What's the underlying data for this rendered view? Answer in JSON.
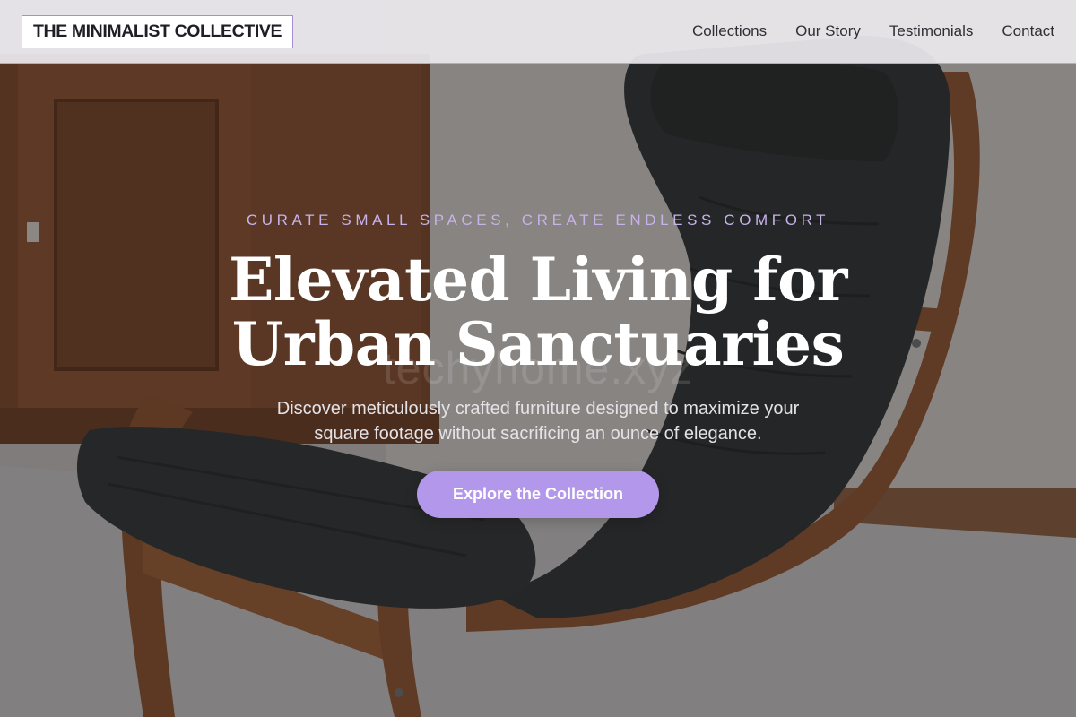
{
  "header": {
    "logo_text": "THE MINIMALIST COLLECTIVE",
    "nav": [
      {
        "label": "Collections"
      },
      {
        "label": "Our Story"
      },
      {
        "label": "Testimonials"
      },
      {
        "label": "Contact"
      }
    ]
  },
  "hero": {
    "eyebrow": "CURATE SMALL SPACES, CREATE ENDLESS COMFORT",
    "headline_line1": "Elevated Living for",
    "headline_line2": "Urban Sanctuaries",
    "watermark": "techyhome.xyz",
    "subtitle": "Discover meticulously crafted furniture designed to maximize your square footage without sacrificing an ounce of elegance.",
    "cta_label": "Explore the Collection",
    "background_image": "armchair-in-room-photo"
  },
  "colors": {
    "accent": "#b397ea",
    "eyebrow": "#c7b2ea",
    "logo_border": "#a58fd2",
    "header_bg": "#eceaee"
  }
}
